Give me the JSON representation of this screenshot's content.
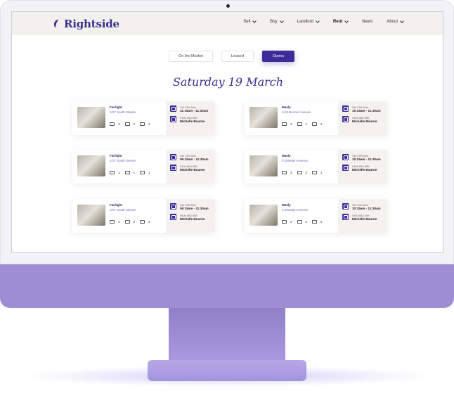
{
  "brand": {
    "name": "Rightside"
  },
  "nav": [
    {
      "label": "Sell",
      "chevron": true
    },
    {
      "label": "Buy",
      "chevron": true
    },
    {
      "label": "Landlord",
      "chevron": true
    },
    {
      "label": "Rent",
      "chevron": true,
      "active": true
    },
    {
      "label": "News",
      "chevron": false
    },
    {
      "label": "About",
      "chevron": true
    }
  ],
  "tabs": [
    {
      "label": "On the Market"
    },
    {
      "label": "Leased"
    },
    {
      "label": "Opens",
      "active": true
    }
  ],
  "date_heading": "Saturday 19 March",
  "listings": [
    {
      "title": "Fairlight",
      "address": "1/17 South Steyne",
      "beds": "3",
      "baths": "2",
      "cars": "2",
      "date": "Sat 19th Mar",
      "time": "11:15am - 11:30am",
      "phone": "0400 864 855",
      "agent": "Michelle Bourne"
    },
    {
      "title": "Manly",
      "address": "1/15 Bonner Avenue",
      "beds": "3",
      "baths": "1",
      "cars": "2",
      "date": "Sat 19th Mar",
      "time": "10:15am - 11:30am",
      "phone": "0400 864 855",
      "agent": "Michelle Bourne"
    },
    {
      "title": "Fairlight",
      "address": "1/17 South Steyne",
      "beds": "1",
      "baths": "1",
      "cars": "1",
      "date": "Sat 19th Mar",
      "time": "09:15am - 11:30am",
      "phone": "0400 864 855",
      "agent": "Michelle Bourne"
    },
    {
      "title": "Manly",
      "address": "5 Dresden Avenue",
      "beds": "3",
      "baths": "2",
      "cars": "1",
      "date": "Sat 19th Mar",
      "time": "10:15am - 11:30am",
      "phone": "0400 864 855",
      "agent": "Michelle Bourne"
    },
    {
      "title": "Fairlight",
      "address": "1/17 South Steyne",
      "beds": "4",
      "baths": "2",
      "cars": "2",
      "date": "Sat 19th Mar",
      "time": "09:15am - 11:30am",
      "phone": "0400 864 855",
      "agent": "Michelle Bourne"
    },
    {
      "title": "Manly",
      "address": "5 Dresden Avenue",
      "beds": "2",
      "baths": "2",
      "cars": "2",
      "date": "Sat 19th Mar",
      "time": "10:15am - 11:30am",
      "phone": "0400 864 855",
      "agent": "Michelle Bourne"
    }
  ],
  "colors": {
    "accent": "#3d2b99",
    "monitor": "#9d8ed3"
  }
}
